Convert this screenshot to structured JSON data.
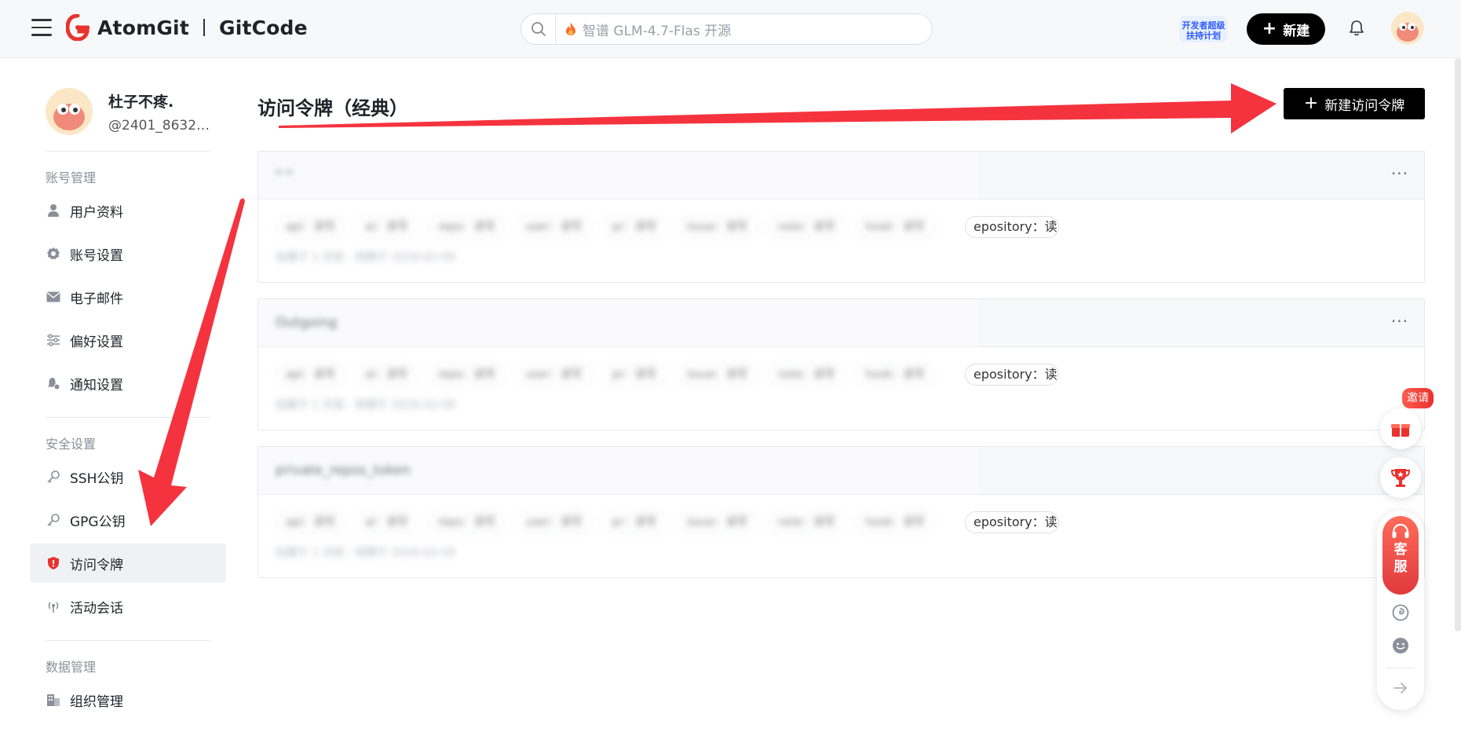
{
  "header": {
    "brand_primary": "AtomGit",
    "brand_secondary": "GitCode",
    "search_placeholder": "智谱 GLM-4.7-Flas 开源",
    "promo_badge_text": "开发者超级扶持计划",
    "new_button_label": "新建"
  },
  "sidebar": {
    "profile": {
      "name": "杜子不疼.",
      "handle": "@2401_8632…"
    },
    "sections": [
      {
        "title": "账号管理",
        "items": [
          "用户资料",
          "账号设置",
          "电子邮件",
          "偏好设置",
          "通知设置"
        ]
      },
      {
        "title": "安全设置",
        "items": [
          "SSH公钥",
          "GPG公钥",
          "访问令牌",
          "活动会话"
        ]
      },
      {
        "title": "数据管理",
        "items": [
          "组织管理"
        ]
      }
    ],
    "active_item": "访问令牌"
  },
  "main": {
    "title": "访问令牌（经典）",
    "new_token_button": "新建访问令牌",
    "tokens": [
      {
        "name_blurred": "ᴴ ᴴ",
        "visible_scope": "epository：读写",
        "more": "···"
      },
      {
        "name_blurred": "Outgoing",
        "visible_scope": "epository：读写",
        "more": "···"
      },
      {
        "name_blurred": "private_repos_token",
        "visible_scope": "epository：读写",
        "more": "···"
      }
    ],
    "blurred_scopes": [
      "api：读写",
      "ai：读写",
      "repo：读写",
      "user：读写",
      "pr：读写",
      "issue：读写",
      "note：读写",
      "hook：读写",
      "r"
    ],
    "blurred_meta": "创建于 1 天前 · 到期于 2026-02-09"
  },
  "floating": {
    "invite_badge": "邀请",
    "service_label_1": "客",
    "service_label_2": "服"
  },
  "colors": {
    "accent_red": "#e8322e",
    "primary_black": "#000000",
    "active_bg": "#f0f1f4",
    "annotation_arrow": "#f5333f"
  }
}
